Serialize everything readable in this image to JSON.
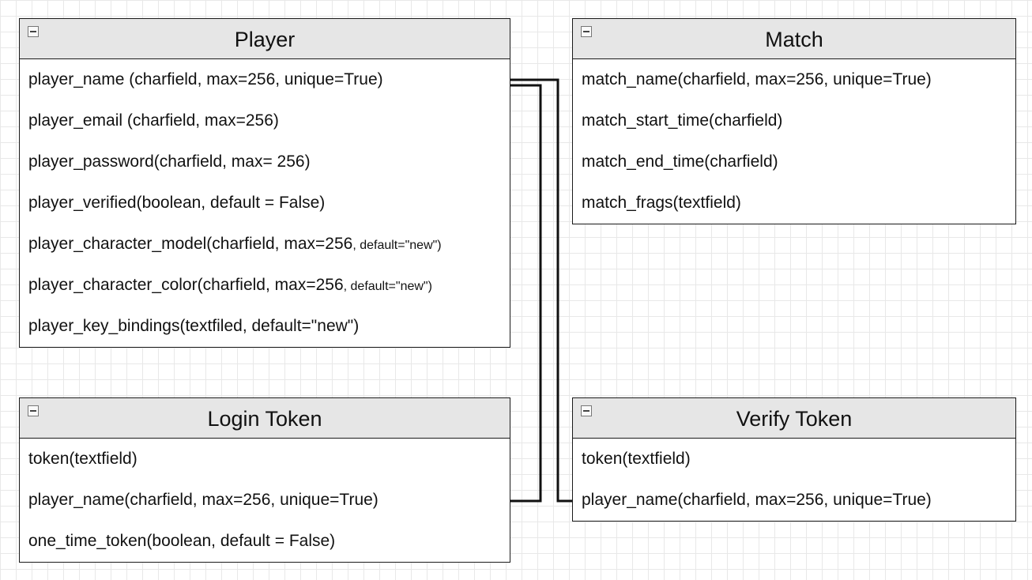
{
  "tables": {
    "player": {
      "title": "Player",
      "fields": [
        "player_name (charfield, max=256, unique=True)",
        "player_email (charfield, max=256)",
        "player_password(charfield, max= 256)",
        "player_verified(boolean, default = False)",
        "player_character_model(charfield, max=256",
        "player_character_color(charfield, max=256",
        "player_key_bindings(textfiled, default=\"new\")"
      ],
      "model_suffix": ", default=\"new\")",
      "color_suffix": ", default=\"new\")"
    },
    "match": {
      "title": "Match",
      "fields": [
        "match_name(charfield, max=256, unique=True)",
        "match_start_time(charfield)",
        "match_end_time(charfield)",
        "match_frags(textfield)"
      ]
    },
    "login_token": {
      "title": "Login Token",
      "fields": [
        "token(textfield)",
        "player_name(charfield, max=256, unique=True)",
        "one_time_token(boolean, default = False)"
      ]
    },
    "verify_token": {
      "title": "Verify Token",
      "fields": [
        "token(textfield)",
        "player_name(charfield, max=256, unique=True)"
      ]
    }
  },
  "colors": {
    "header_bg": "#e6e6e6",
    "border": "#1a1a1a",
    "grid": "#e8e8e8"
  },
  "icons": {
    "collapse": "collapse-minus-icon"
  }
}
